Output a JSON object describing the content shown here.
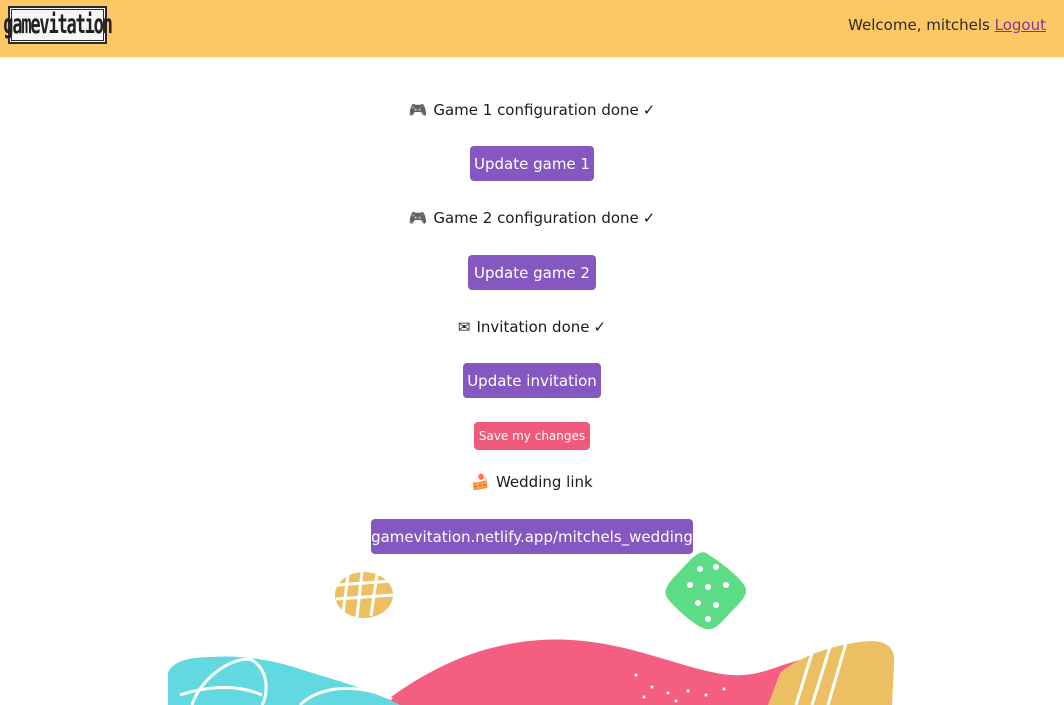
{
  "header": {
    "logo_text": "gamevitation",
    "welcome_text": "Welcome, mitchels",
    "logout_label": "Logout"
  },
  "steps": {
    "game1": {
      "icon": "gamepad-icon",
      "glyph": "🎮",
      "text": "Game 1 configuration done",
      "check": "✓",
      "button": "Update game 1"
    },
    "game2": {
      "icon": "gamepad-icon",
      "glyph": "🎮",
      "text": "Game 2 configuration done",
      "check": "✓",
      "button": "Update game 2"
    },
    "invitation": {
      "icon": "envelope-icon",
      "glyph": "✉",
      "text": "Invitation done",
      "check": "✓",
      "button": "Update invitation"
    }
  },
  "save_label": "Save my changes",
  "wedding": {
    "icon": "cake-icon",
    "glyph": "🍰",
    "label": "Wedding link",
    "link": "gamevitation.netlify.app/mitchels_wedding"
  },
  "colors": {
    "header": "#fdc765",
    "button": "#8558c1",
    "save_button": "#f05a7a",
    "wave_cyan": "#62d9e1",
    "wave_pink": "#f45e80",
    "wave_yellow": "#ecc062",
    "blob_green": "#5ddc86"
  }
}
